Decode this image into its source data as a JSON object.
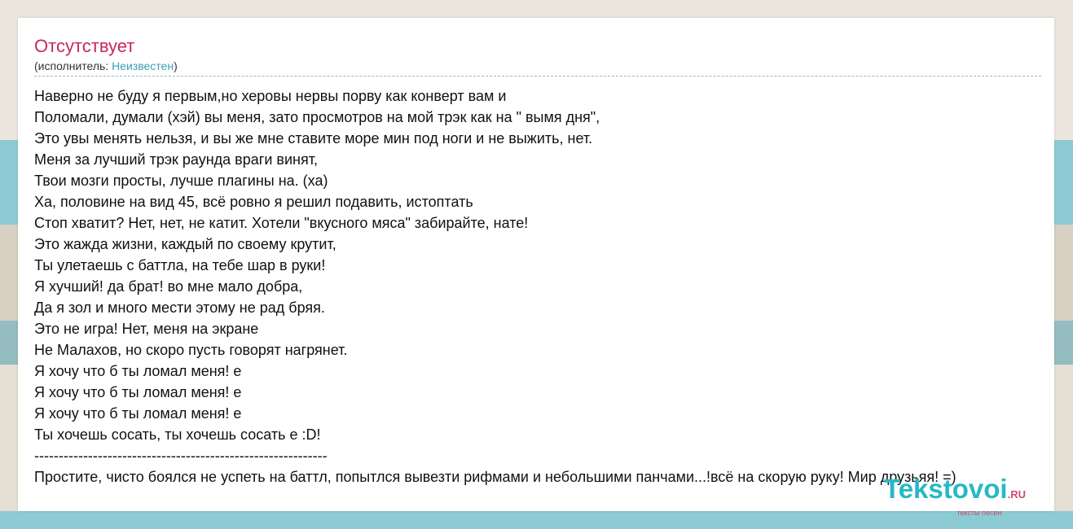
{
  "song": {
    "title": "Отсутствует",
    "artist_prefix": "(исполнитель: ",
    "artist_name": "Неизвестен",
    "artist_suffix": ")"
  },
  "lyrics": [
    "Наверно не буду я первым,но херовы нервы порву как конверт вам и",
    "Поломали, думали (хэй) вы меня, зато просмотров на мой трэк как на \" вымя дня\",",
    "Это увы менять нельзя, и вы же мне ставите море мин под ноги и не выжить, нет.",
    "Меня за лучший трэк раунда враги винят,",
    "Твои мозги просты, лучше плагины на. (ха)",
    "Ха, половине на вид 45, всё ровно я решил подавить, истоптать",
    "Стоп хватит? Нет, нет, не катит. Хотели \"вкусного мяса\" забирайте, нате!",
    "Это жажда жизни, каждый по своему крутит,",
    "Ты улетаешь с баттла, на тебе шар в руки!",
    "Я хучший! да брат! во мне мало добра,",
    "Да я зол и много мести этому не рад бряя.",
    "Это не игра! Нет, меня на экране",
    "Не Малахов, но скоро пусть говорят нагрянет.",
    "Я хочу что б ты ломал меня! е",
    "Я хочу что б ты ломал меня! е",
    "Я хочу что б ты ломал меня! е",
    "Ты хочешь сосать, ты хочешь сосать е :D!",
    "------------------------------------------------------------",
    "Простите, чисто боялся не успеть на баттл, попытлся вывезти рифмами и небольшими панчами...!всё на скорую руку! Мир друзьяя! =)"
  ],
  "logo": {
    "main": "Tekstovoi",
    "domain": ".RU",
    "tagline": "тексты песен"
  },
  "colors": {
    "title": "#c8275a",
    "link": "#3aa0b8",
    "logo": "#27b8c4",
    "logo_accent": "#d24a72"
  }
}
